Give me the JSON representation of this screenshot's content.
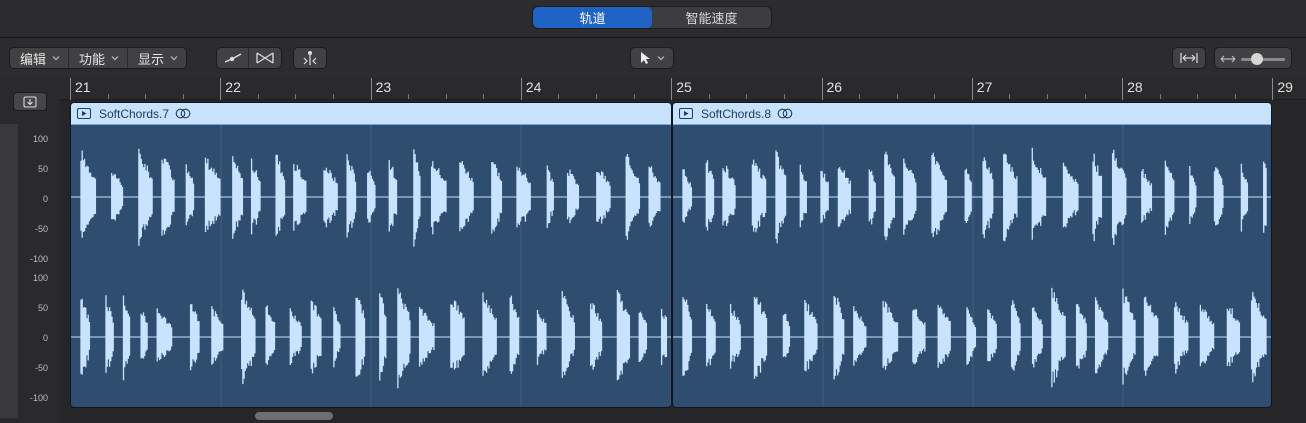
{
  "tabs": [
    {
      "label": "轨道",
      "active": true
    },
    {
      "label": "智能速度",
      "active": false
    }
  ],
  "toolbar": {
    "menus": [
      "编辑",
      "功能",
      "显示"
    ],
    "icons": [
      "snap-line-icon",
      "crossfade-icon",
      "split-icon"
    ],
    "pointer_tool": "pointer-icon",
    "fit_icon": "fit-width-icon",
    "zoom_icon": "horizontal-zoom-icon"
  },
  "ruler": {
    "bars": [
      "21",
      "22",
      "23",
      "24",
      "25",
      "26",
      "27",
      "28",
      "29"
    ]
  },
  "amplitude_labels": [
    "100",
    "50",
    "0",
    "-50",
    "-100",
    "100",
    "50",
    "0",
    "-50",
    "-100"
  ],
  "regions": [
    {
      "name": "SoftChords.7"
    },
    {
      "name": "SoftChords.8"
    }
  ],
  "colors": {
    "accent": "#1f64c4",
    "region_header": "#c9e2fb",
    "region_body": "#2f4d6e",
    "waveform": "#c7e3ff"
  }
}
